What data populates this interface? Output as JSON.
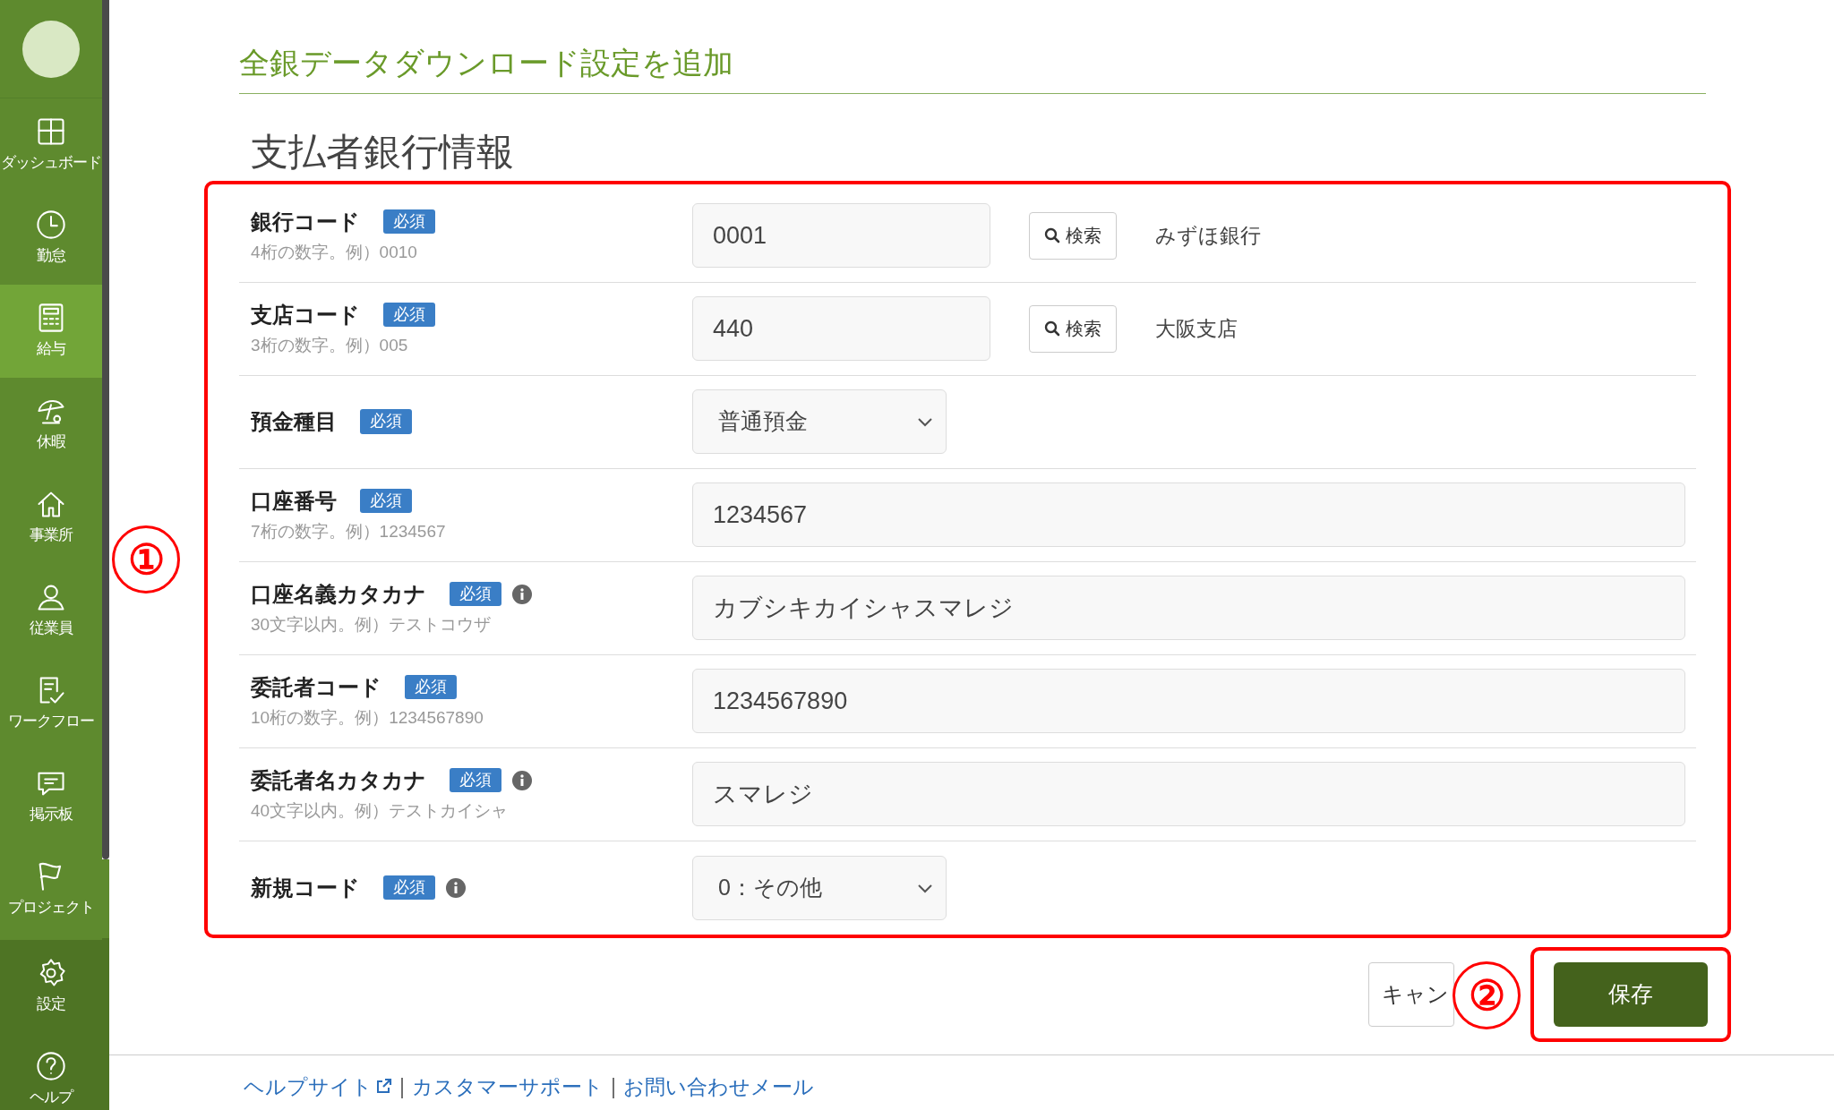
{
  "sidebar": {
    "items": [
      {
        "label": "ダッシュボード",
        "kind": "dashboard",
        "selected": false
      },
      {
        "label": "勤怠",
        "kind": "clock",
        "selected": false
      },
      {
        "label": "給与",
        "kind": "calculator",
        "selected": true
      },
      {
        "label": "休暇",
        "kind": "umbrella",
        "selected": false
      },
      {
        "label": "事業所",
        "kind": "house",
        "selected": false
      },
      {
        "label": "従業員",
        "kind": "person",
        "selected": false
      },
      {
        "label": "ワークフロー",
        "kind": "checklist",
        "selected": false
      },
      {
        "label": "掲示板",
        "kind": "chat",
        "selected": false
      },
      {
        "label": "プロジェクト",
        "kind": "flag",
        "selected": false
      }
    ],
    "bottom_items": [
      {
        "label": "設定",
        "kind": "gear",
        "selected": false
      },
      {
        "label": "ヘルプ",
        "kind": "help",
        "selected": false
      }
    ]
  },
  "page_title": "全銀データダウンロード設定を追加",
  "section_title": "支払者銀行情報",
  "fields": [
    {
      "label": "銀行コード",
      "badge": "必須",
      "info": false,
      "hint": "4桁の数字。例）0010",
      "kind": "search",
      "value": "0001",
      "search_button": "検索",
      "result": "みずほ銀行"
    },
    {
      "label": "支店コード",
      "badge": "必須",
      "info": false,
      "hint": "3桁の数字。例）005",
      "kind": "search",
      "value": "440",
      "search_button": "検索",
      "result": "大阪支店"
    },
    {
      "label": "預金種目",
      "badge": "必須",
      "info": false,
      "kind": "select",
      "value": "普通預金"
    },
    {
      "label": "口座番号",
      "badge": "必須",
      "info": false,
      "hint": "7桁の数字。例）1234567",
      "kind": "input",
      "value": "1234567"
    },
    {
      "label": "口座名義カタカナ",
      "badge": "必須",
      "info": true,
      "hint": "30文字以内。例）テストコウザ",
      "kind": "input",
      "value": "カブシキカイシャスマレジ"
    },
    {
      "label": "委託者コード",
      "badge": "必須",
      "info": false,
      "hint": "10桁の数字。例）1234567890",
      "kind": "input",
      "value": "1234567890"
    },
    {
      "label": "委託者名カタカナ",
      "badge": "必須",
      "info": true,
      "hint": "40文字以内。例）テストカイシャ",
      "kind": "input",
      "value": "スマレジ"
    },
    {
      "label": "新規コード",
      "badge": "必須",
      "info": true,
      "kind": "select",
      "value": "0：その他"
    }
  ],
  "buttons": {
    "cancel": "キャン",
    "save": "保存"
  },
  "annotations": [
    {
      "text": "①"
    },
    {
      "text": "②"
    }
  ],
  "footer_links": [
    {
      "text": "ヘルプサイト",
      "external": true
    },
    {
      "text": "カスタマーサポート",
      "external": false
    },
    {
      "text": "お問い合わせメール",
      "external": false
    }
  ],
  "footer_separators": [
    "|",
    "|"
  ]
}
